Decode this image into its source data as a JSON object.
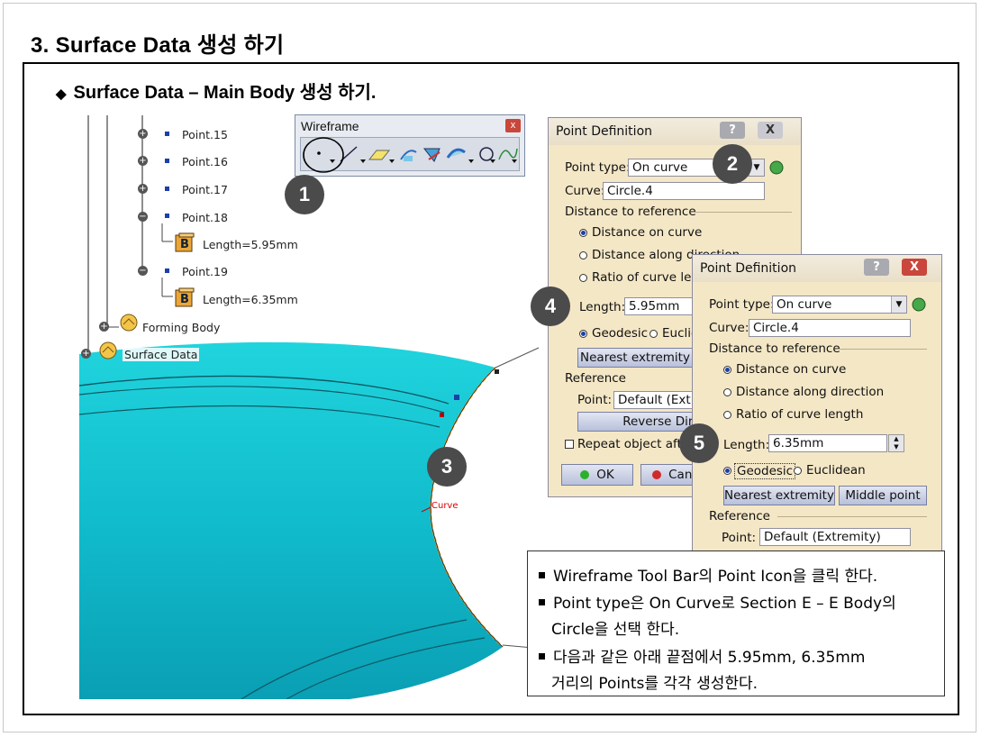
{
  "slide": {
    "title": "3. Surface Data 생성 하기",
    "subtitle": "Surface Data – Main Body 생성 하기.",
    "subtitle_bullet": "◆"
  },
  "tree": {
    "items": [
      {
        "label": "Point.15",
        "toggle": "+"
      },
      {
        "label": "Point.16",
        "toggle": "+"
      },
      {
        "label": "Point.17",
        "toggle": "+"
      },
      {
        "label": "Point.18",
        "toggle": "−"
      },
      {
        "label": "Length=5.95mm"
      },
      {
        "label": "Point.19",
        "toggle": "−"
      },
      {
        "label": "Length=6.35mm"
      },
      {
        "label": "Forming Body",
        "toggle": "+"
      },
      {
        "label": "Surface Data",
        "toggle": "+"
      }
    ]
  },
  "viewport": {
    "curve_label": "Curve",
    "surface_color": "#16c7d4"
  },
  "toolbar": {
    "title": "Wireframe",
    "close": "x",
    "buttons": [
      "point-icon",
      "line-icon",
      "plane-icon",
      "projection-icon",
      "intersection-icon",
      "offset-icon",
      "circle-icon",
      "spline-icon"
    ]
  },
  "badges": [
    "1",
    "2",
    "3",
    "4",
    "5"
  ],
  "dialog1": {
    "title": "Point Definition",
    "help": "?",
    "close": "X",
    "point_type_label": "Point type:",
    "point_type_value": "On curve",
    "curve_label": "Curve:",
    "curve_value": "Circle.4",
    "distance_ref_label": "Distance to reference",
    "opt_distance_on_curve": "Distance on curve",
    "opt_distance_along_direction": "Distance along direction",
    "opt_ratio": "Ratio of curve length",
    "length_label": "Length:",
    "length_value": "5.95mm",
    "geodesic": "Geodesic",
    "euclidean": "Euclidean",
    "nearest_extremity": "Nearest extremity",
    "reference_label": "Reference",
    "point_label": "Point:",
    "point_value": "Default (Extremity)",
    "reverse_direction": "Reverse Direction",
    "repeat_object": "Repeat object after OK",
    "ok": "OK",
    "cancel": "Cancel"
  },
  "dialog2": {
    "title": "Point Definition",
    "help": "?",
    "close": "X",
    "point_type_label": "Point type:",
    "point_type_value": "On curve",
    "curve_label": "Curve:",
    "curve_value": "Circle.4",
    "distance_ref_label": "Distance to reference",
    "opt_distance_on_curve": "Distance on curve",
    "opt_distance_along_direction": "Distance along direction",
    "opt_ratio": "Ratio of curve length",
    "length_label": "Length:",
    "length_value": "6.35mm",
    "geodesic": "Geodesic",
    "euclidean": "Euclidean",
    "nearest_extremity": "Nearest extremity",
    "middle_point": "Middle point",
    "reference_label": "Reference",
    "point_label": "Point:",
    "point_value": "Default (Extremity)"
  },
  "notes": {
    "line1": "Wireframe Tool Bar의 Point Icon을 클릭 한다.",
    "line2a": "Point type은 On Curve로 Section E – E Body의",
    "line2b": "Circle을 선택 한다.",
    "line3a": "다음과 같은 아래 끝점에서 5.95mm, 6.35mm",
    "line3b": "거리의 Points를 각각 생성한다."
  }
}
